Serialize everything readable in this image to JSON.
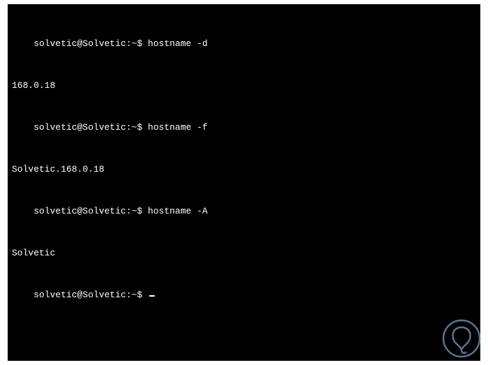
{
  "terminal": {
    "lines": [
      {
        "type": "prompt",
        "prompt": "solvetic@Solvetic:~$ ",
        "command": "hostname -d"
      },
      {
        "type": "output",
        "text": "168.0.18"
      },
      {
        "type": "prompt",
        "prompt": "solvetic@Solvetic:~$ ",
        "command": "hostname -f"
      },
      {
        "type": "output",
        "text": "Solvetic.168.0.18"
      },
      {
        "type": "prompt",
        "prompt": "solvetic@Solvetic:~$ ",
        "command": "hostname -A"
      },
      {
        "type": "output",
        "text": "Solvetic"
      },
      {
        "type": "prompt",
        "prompt": "solvetic@Solvetic:~$ ",
        "command": ""
      }
    ]
  },
  "watermark": {
    "stroke": "#6b8aa8",
    "fill": "#3f5a77"
  }
}
